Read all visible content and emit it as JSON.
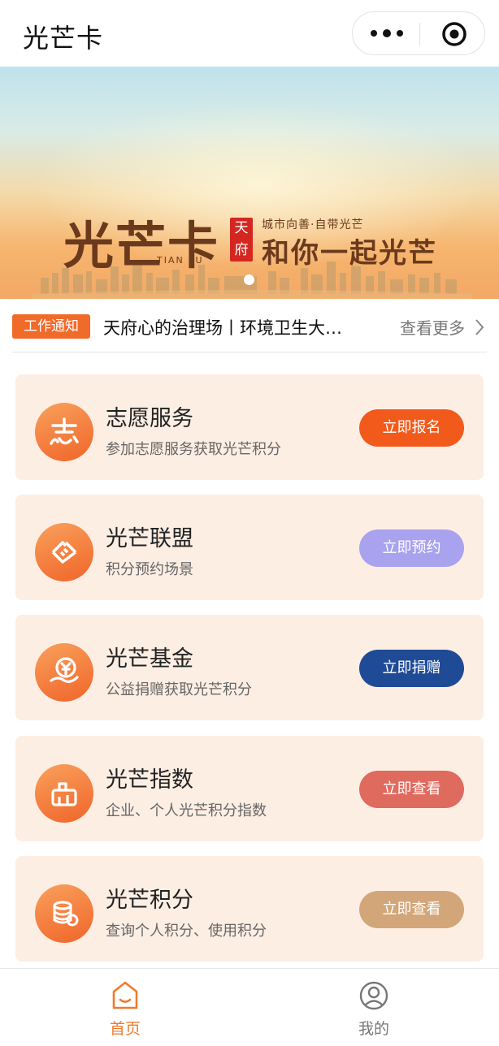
{
  "app": {
    "title": "光芒卡"
  },
  "banner": {
    "big_title": "光芒卡",
    "tianfu": "TIAN FU",
    "seal": "天府",
    "motto": "城市向善·自带光芒",
    "slogan": "和你一起光芒"
  },
  "notice": {
    "tag": "工作通知",
    "text": "天府心的治理场丨环境卫生大…",
    "more": "查看更多"
  },
  "cards": [
    {
      "title": "志愿服务",
      "subtitle": "参加志愿服务获取光芒积分",
      "button": "立即报名",
      "icon": "volunteer-icon",
      "button_color": "#f25a1c"
    },
    {
      "title": "光芒联盟",
      "subtitle": "积分预约场景",
      "button": "立即预约",
      "icon": "handshake-icon",
      "button_color": "#a9a2ee"
    },
    {
      "title": "光芒基金",
      "subtitle": "公益捐赠获取光芒积分",
      "button": "立即捐赠",
      "icon": "yen-hand-icon",
      "button_color": "#1f4a96"
    },
    {
      "title": "光芒指数",
      "subtitle": "企业、个人光芒积分指数",
      "button": "立即查看",
      "icon": "index-icon",
      "button_color": "#df6a5e"
    },
    {
      "title": "光芒积分",
      "subtitle": "查询个人积分、使用积分",
      "button": "立即查看",
      "icon": "coins-icon",
      "button_color": "#d3a679"
    }
  ],
  "tabbar": {
    "home": "首页",
    "mine": "我的",
    "active_color": "#f07a2c",
    "inactive_color": "#777777"
  }
}
